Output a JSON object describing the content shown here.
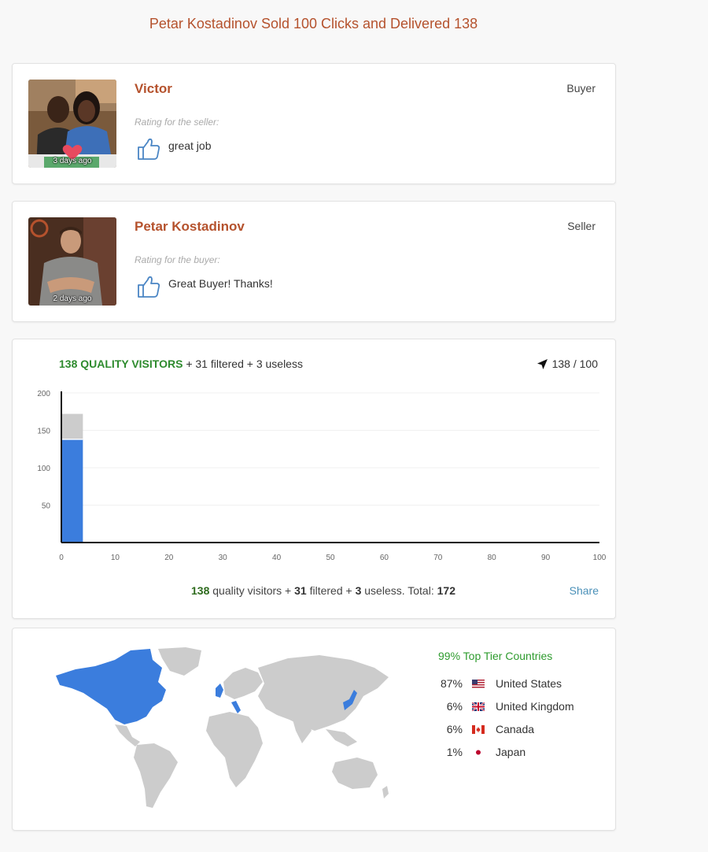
{
  "page": {
    "title": "Petar Kostadinov Sold 100 Clicks and Delivered 138"
  },
  "reviews": [
    {
      "name": "Victor",
      "role": "Buyer",
      "time": "3 days ago",
      "caption": "Rating for the seller:",
      "text": "great job"
    },
    {
      "name": "Petar Kostadinov",
      "role": "Seller",
      "time": "2 days ago",
      "caption": "Rating for the buyer:",
      "text": "Great Buyer! Thanks!"
    }
  ],
  "stats": {
    "quality_count": "138",
    "quality_label": "QUALITY VISITORS",
    "header_rest": "+ 31 filtered + 3 useless",
    "progress": "138 / 100",
    "footer": {
      "quality": "138",
      "t1": " quality visitors + ",
      "filtered": "31",
      "t2": " filtered + ",
      "useless": "3",
      "t3": " useless. Total: ",
      "total": "172"
    },
    "share_label": "Share"
  },
  "chart_data": {
    "type": "bar",
    "x": [
      2
    ],
    "series": [
      {
        "name": "quality",
        "values": [
          138
        ],
        "color": "#3b7ddd"
      },
      {
        "name": "filtered",
        "values": [
          34
        ],
        "color": "#cccccc"
      }
    ],
    "xlim": [
      0,
      100
    ],
    "ylim": [
      0,
      200
    ],
    "xticks": [
      "0",
      "10",
      "20",
      "30",
      "40",
      "50",
      "60",
      "70",
      "80",
      "90",
      "100"
    ],
    "yticks": [
      "50",
      "100",
      "150",
      "200"
    ],
    "stacked": true
  },
  "geo": {
    "top_tier": "99% Top Tier Countries",
    "countries": [
      {
        "pct": "87%",
        "name": "United States",
        "flag": "us-flag-icon"
      },
      {
        "pct": "6%",
        "name": "United Kingdom",
        "flag": "uk-flag-icon"
      },
      {
        "pct": "6%",
        "name": "Canada",
        "flag": "canada-flag-icon"
      },
      {
        "pct": "1%",
        "name": "Japan",
        "flag": "japan-flag-icon"
      }
    ],
    "highlight_color": "#3b7ddd",
    "land_color": "#cccccc"
  }
}
